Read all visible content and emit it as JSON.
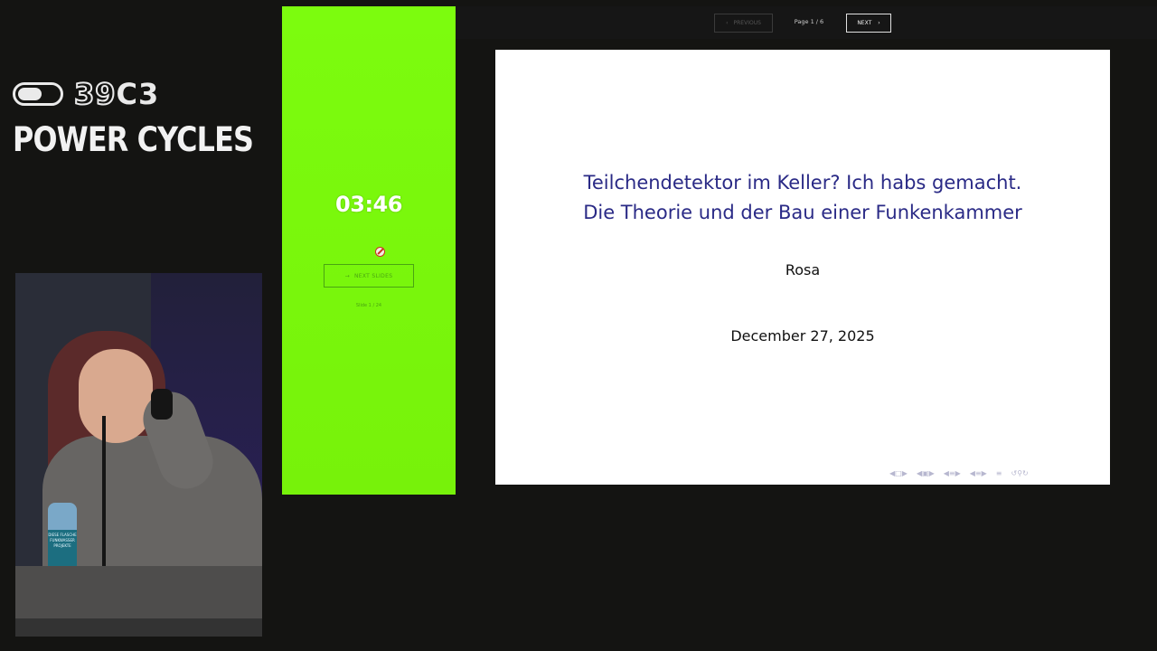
{
  "branding": {
    "logo_number": "39",
    "logo_suffix": "C3",
    "event_title": "POWER CYCLES"
  },
  "timer_panel": {
    "countdown": "03:46",
    "status_icon": "no-entry-icon",
    "next_button_icon": "arrow-right-icon",
    "next_button_label": "NEXT SLIDES",
    "slide_count": "Slide 1 / 24",
    "background_color": "#7CFC0E"
  },
  "pager": {
    "previous_label": "PREVIOUS",
    "page_info": "Page 1 / 6",
    "next_label": "NEXT"
  },
  "slide": {
    "title_line_1": "Teilchendetektor im Keller? Ich habs gemacht.",
    "title_line_2": "Die Theorie und der Bau einer Funkenkammer",
    "author": "Rosa",
    "date": "December 27, 2025",
    "title_color": "#2A2A86"
  },
  "camera": {
    "bottle_label": "DIESE FLASCHE FUNKWASSER PROJEKTE"
  },
  "beamer_nav_icons": [
    "frame-prev-icon",
    "frame-next-icon",
    "subsection-icon",
    "section-icon",
    "doc-icon",
    "search-icon"
  ]
}
